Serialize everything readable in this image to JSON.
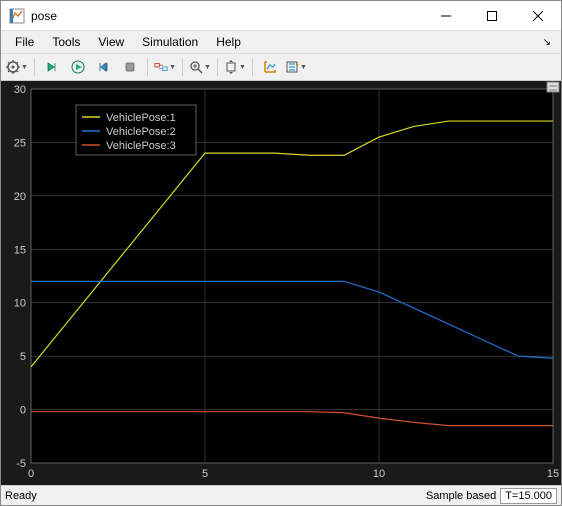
{
  "window": {
    "title": "pose"
  },
  "menu": {
    "file": "File",
    "tools": "Tools",
    "view": "View",
    "simulation": "Simulation",
    "help": "Help"
  },
  "status": {
    "ready": "Ready",
    "sample_based": "Sample based",
    "time": "T=15.000"
  },
  "legend": {
    "s1": "VehiclePose:1",
    "s2": "VehiclePose:2",
    "s3": "VehiclePose:3"
  },
  "colors": {
    "bg": "#1a1a1a",
    "grid": "#606060",
    "axis_text": "#cccccc",
    "s1": "#d8d820",
    "s2": "#2070d0",
    "s3": "#d05030"
  },
  "chart_data": {
    "type": "line",
    "xlim": [
      0,
      15
    ],
    "ylim": [
      -5,
      30
    ],
    "xticks": [
      0,
      5,
      10,
      15
    ],
    "yticks": [
      -5,
      0,
      5,
      10,
      15,
      20,
      25,
      30
    ],
    "x": [
      0,
      1,
      2,
      3,
      4,
      5,
      6,
      7,
      8,
      9,
      10,
      11,
      12,
      13,
      14,
      15
    ],
    "series": [
      {
        "name": "VehiclePose:1",
        "color": "#d8d820",
        "values": [
          4.0,
          8.0,
          12.0,
          16.0,
          20.0,
          24.0,
          24.0,
          24.0,
          23.8,
          23.8,
          25.5,
          26.5,
          27.0,
          27.0,
          27.0,
          27.0
        ]
      },
      {
        "name": "VehiclePose:2",
        "color": "#2070d0",
        "values": [
          12.0,
          12.0,
          12.0,
          12.0,
          12.0,
          12.0,
          12.0,
          12.0,
          12.0,
          12.0,
          11.0,
          9.5,
          8.0,
          6.5,
          5.0,
          4.8
        ]
      },
      {
        "name": "VehiclePose:3",
        "color": "#d05030",
        "values": [
          -0.2,
          -0.2,
          -0.2,
          -0.2,
          -0.2,
          -0.2,
          -0.2,
          -0.2,
          -0.2,
          -0.3,
          -0.8,
          -1.2,
          -1.5,
          -1.5,
          -1.5,
          -1.5
        ]
      }
    ]
  }
}
